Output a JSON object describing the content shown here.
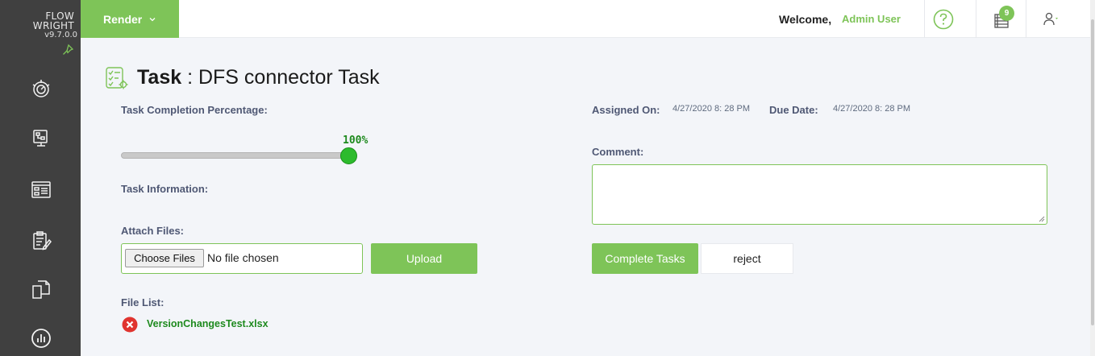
{
  "sidebar": {
    "logo_line1": "FLOW",
    "logo_line2": "WRIGHT",
    "version": "v9.7.0.0",
    "nav_icons": [
      "dashboard-icon",
      "workflow-design-icon",
      "forms-icon",
      "tasks-icon",
      "documents-icon",
      "reports-icon"
    ]
  },
  "topbar": {
    "render_label": "Render",
    "welcome_label": "Welcome,",
    "user_name": "Admin User",
    "inbox_badge": "9"
  },
  "page": {
    "title_bold": "Task",
    "title_rest": " : DFS connector Task"
  },
  "task": {
    "completion_label": "Task Completion Percentage:",
    "completion_value": "100%",
    "completion_fraction": 1.0,
    "info_label": "Task Information:",
    "attach_label": "Attach Files:",
    "choose_files": "Choose Files",
    "no_file": "No file chosen",
    "upload": "Upload",
    "file_list_label": "File List:",
    "files": [
      "VersionChangesTest.xlsx"
    ]
  },
  "details": {
    "assigned_label": "Assigned On:",
    "assigned_value": "4/27/2020 8: 28 PM",
    "due_label": "Due Date:",
    "due_value": "4/27/2020 8: 28 PM",
    "comment_label": "Comment:",
    "comment_value": "",
    "complete_button": "Complete Tasks",
    "reject_button": "reject"
  },
  "colors": {
    "accent": "#7ec458",
    "sidebar": "#404040",
    "label": "#4f5874",
    "success_text": "#1e8a1e",
    "slider_thumb": "#2dbb2d"
  }
}
